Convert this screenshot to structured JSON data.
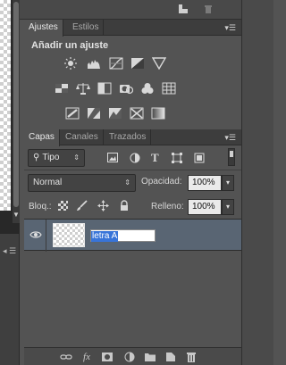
{
  "colors": {
    "panel_bg": "#535353",
    "tab_bar": "#3d3d3d",
    "selected_layer": "#596573",
    "highlight": "#3874d8"
  },
  "adjustments_panel": {
    "tabs": [
      {
        "label": "Ajustes",
        "active": true
      },
      {
        "label": "Estilos",
        "active": false
      }
    ],
    "title": "Añadir un ajuste",
    "rows": [
      [
        "brightness-icon",
        "levels-icon",
        "curves-icon",
        "exposure-icon",
        "gradient-triangle-icon"
      ],
      [
        "vibrance-icon",
        "color-balance-icon",
        "black-white-icon",
        "photo-filter-icon",
        "channel-mixer-icon",
        "color-lookup-icon"
      ],
      [
        "invert-icon",
        "posterize-icon",
        "threshold-icon",
        "selective-color-icon",
        "gradient-map-icon"
      ]
    ]
  },
  "layers_panel": {
    "tabs": [
      {
        "label": "Capas",
        "active": true
      },
      {
        "label": "Canales",
        "active": false
      },
      {
        "label": "Trazados",
        "active": false
      }
    ],
    "filter": {
      "value": "Tipo",
      "icons": [
        "image-filter-icon",
        "adjustment-filter-icon",
        "text-filter-icon",
        "shape-filter-icon",
        "smart-object-filter-icon"
      ]
    },
    "blend_mode": "Normal",
    "opacity": {
      "label": "Opacidad:",
      "value": "100%"
    },
    "lock": {
      "label": "Bloq.:",
      "icons": [
        "lock-transparent-icon",
        "lock-paint-icon",
        "lock-move-icon",
        "lock-all-icon"
      ]
    },
    "fill": {
      "label": "Relleno:",
      "value": "100%"
    },
    "layers": [
      {
        "name": "letra A",
        "visible": true,
        "editing": true
      }
    ],
    "bottom_icons": [
      "link-icon",
      "fx-icon",
      "mask-icon",
      "adjustment-layer-icon",
      "group-folder-icon",
      "new-layer-icon",
      "trash-icon"
    ],
    "fx_label": "fx"
  }
}
